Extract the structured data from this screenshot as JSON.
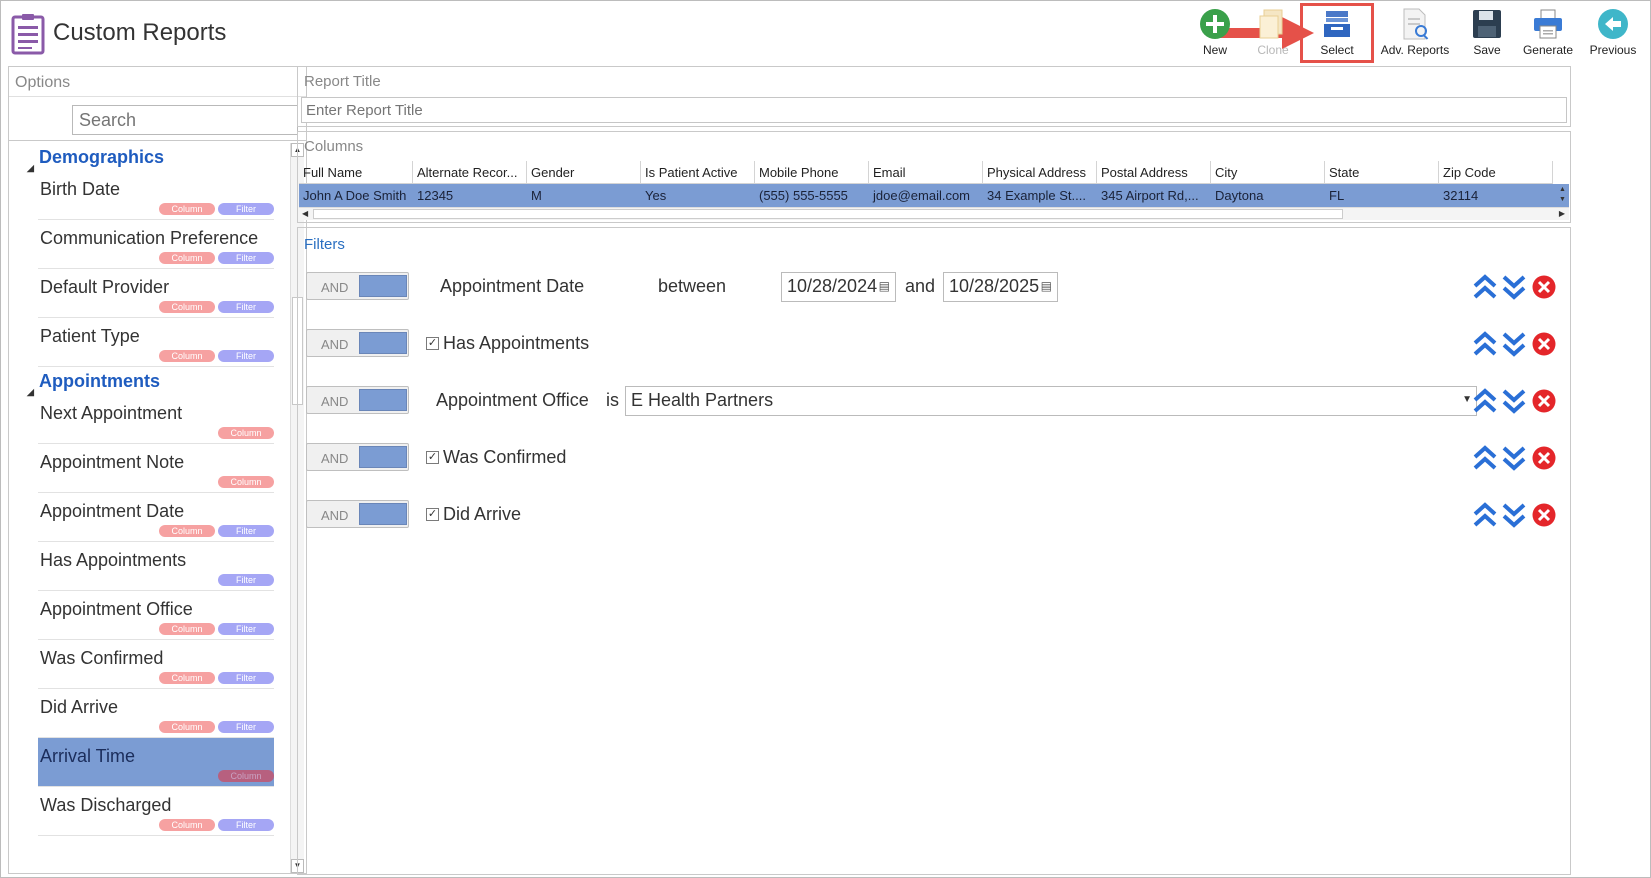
{
  "app": {
    "title": "Custom Reports"
  },
  "toolbar": {
    "new": "New",
    "clone": "Clone",
    "select": "Select",
    "adv_reports": "Adv. Reports",
    "save": "Save",
    "generate": "Generate",
    "previous": "Previous",
    "highlight_color": "#e55149"
  },
  "options": {
    "title": "Options",
    "search_placeholder": "Search",
    "groups": [
      {
        "label": "Demographics",
        "items": [
          {
            "label": "Birth Date",
            "tags": [
              "Column",
              "Filter"
            ]
          },
          {
            "label": "Communication Preference",
            "tags": [
              "Column",
              "Filter"
            ]
          },
          {
            "label": "Default Provider",
            "tags": [
              "Column",
              "Filter"
            ]
          },
          {
            "label": "Patient Type",
            "tags": [
              "Column",
              "Filter"
            ]
          }
        ]
      },
      {
        "label": "Appointments",
        "items": [
          {
            "label": "Next Appointment",
            "tags": [
              "Column"
            ]
          },
          {
            "label": "Appointment Note",
            "tags": [
              "Column"
            ]
          },
          {
            "label": "Appointment Date",
            "tags": [
              "Column",
              "Filter"
            ]
          },
          {
            "label": "Has Appointments",
            "tags": [
              "Filter"
            ]
          },
          {
            "label": "Appointment Office",
            "tags": [
              "Column",
              "Filter"
            ]
          },
          {
            "label": "Was Confirmed",
            "tags": [
              "Column",
              "Filter"
            ]
          },
          {
            "label": "Did Arrive",
            "tags": [
              "Column",
              "Filter"
            ]
          },
          {
            "label": "Arrival Time",
            "tags": [
              "Column"
            ],
            "selected": true
          },
          {
            "label": "Was Discharged",
            "tags": [
              "Column",
              "Filter"
            ]
          }
        ]
      }
    ]
  },
  "report_title": {
    "label": "Report Title",
    "placeholder": "Enter Report Title"
  },
  "columns": {
    "label": "Columns",
    "headers": [
      "Full Name",
      "Alternate Recor...",
      "Gender",
      "Is Patient Active",
      "Mobile Phone",
      "Email",
      "Physical Address",
      "Postal Address",
      "City",
      "State",
      "Zip Code"
    ],
    "row": [
      "John A Doe Smith",
      "12345",
      "M",
      "Yes",
      "(555) 555-5555",
      "jdoe@email.com",
      "34 Example St....",
      "345 Airport Rd,...",
      "Daytona",
      "FL",
      "32114"
    ]
  },
  "filters": {
    "label": "Filters",
    "and_label": "AND",
    "rows": {
      "appt_date": {
        "field": "Appointment Date",
        "operator": "between",
        "from": "10/28/2024",
        "joiner": "and",
        "to": "10/28/2025"
      },
      "has_appts": {
        "field": "Has Appointments",
        "checked": true
      },
      "office": {
        "field": "Appointment Office",
        "operator": "is",
        "value": "E Health Partners"
      },
      "confirmed": {
        "field": "Was Confirmed",
        "checked": true
      },
      "arrive": {
        "field": "Did Arrive",
        "checked": true
      }
    }
  }
}
